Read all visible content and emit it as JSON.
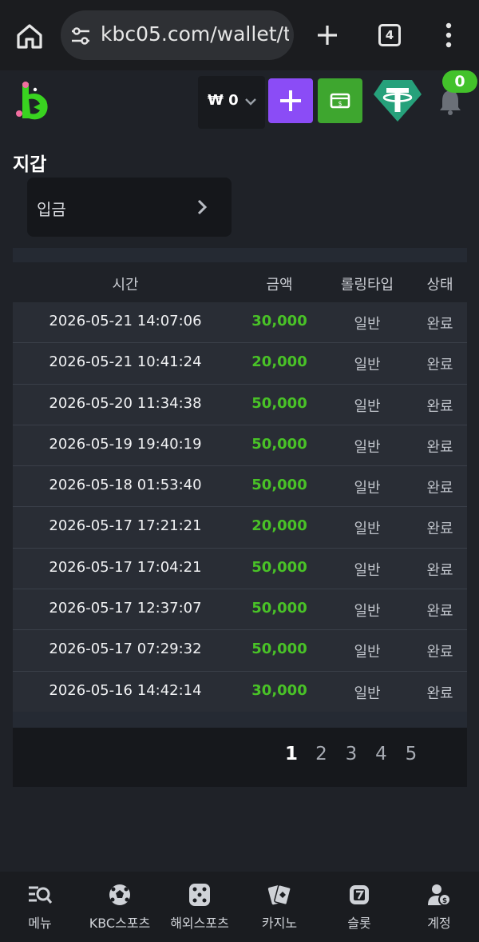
{
  "browser": {
    "url": "kbc05.com/wallet/tra",
    "tab_count": "4"
  },
  "header": {
    "balance": "₩ 0",
    "notification_count": "0"
  },
  "page": {
    "title": "지갑",
    "tab_label": "입금"
  },
  "table": {
    "columns": [
      "시간",
      "금액",
      "롤링타입",
      "상태"
    ],
    "rows": [
      {
        "time": "2026-05-21 14:07:06",
        "amount": "30,000",
        "type": "일반",
        "status": "완료"
      },
      {
        "time": "2026-05-21 10:41:24",
        "amount": "20,000",
        "type": "일반",
        "status": "완료"
      },
      {
        "time": "2026-05-20 11:34:38",
        "amount": "50,000",
        "type": "일반",
        "status": "완료"
      },
      {
        "time": "2026-05-19 19:40:19",
        "amount": "50,000",
        "type": "일반",
        "status": "완료"
      },
      {
        "time": "2026-05-18 01:53:40",
        "amount": "50,000",
        "type": "일반",
        "status": "완료"
      },
      {
        "time": "2026-05-17 17:21:21",
        "amount": "20,000",
        "type": "일반",
        "status": "완료"
      },
      {
        "time": "2026-05-17 17:04:21",
        "amount": "50,000",
        "type": "일반",
        "status": "완료"
      },
      {
        "time": "2026-05-17 12:37:07",
        "amount": "50,000",
        "type": "일반",
        "status": "완료"
      },
      {
        "time": "2026-05-17 07:29:32",
        "amount": "50,000",
        "type": "일반",
        "status": "완료"
      },
      {
        "time": "2026-05-16 14:42:14",
        "amount": "30,000",
        "type": "일반",
        "status": "완료"
      }
    ]
  },
  "pagination": {
    "pages": [
      "1",
      "2",
      "3",
      "4",
      "5"
    ],
    "current": "1"
  },
  "bottom_nav": [
    {
      "label": "메뉴",
      "icon": "menu-search-icon"
    },
    {
      "label": "KBC스포츠",
      "icon": "soccer-ball-icon"
    },
    {
      "label": "해외스포츠",
      "icon": "dice-icon"
    },
    {
      "label": "카지노",
      "icon": "cards-icon"
    },
    {
      "label": "슬롯",
      "icon": "slot-seven-icon"
    },
    {
      "label": "계정",
      "icon": "account-icon"
    }
  ],
  "colors": {
    "amount_green": "#49c227",
    "deposit_purple": "#8b4cf6",
    "cash_green": "#3ea62f",
    "tether_teal": "#26a17b"
  }
}
